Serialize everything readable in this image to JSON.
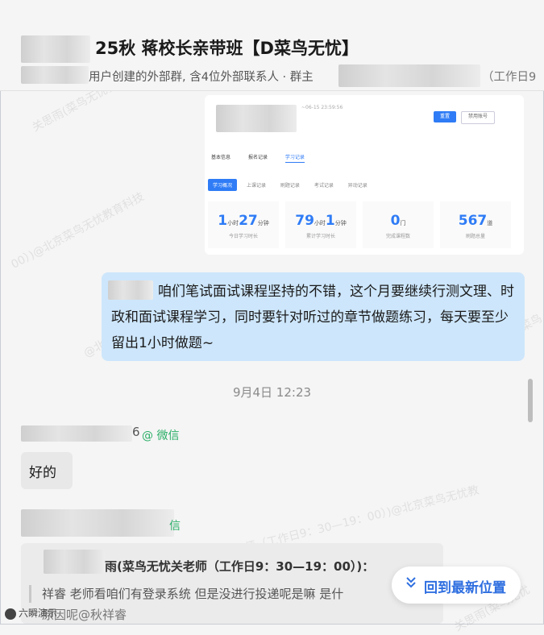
{
  "header": {
    "title_visible": "25秋 蒋校长亲带班【D菜鸟无忧】",
    "subtitle_visible": "用户创建的外部群, 含4位外部联系人 · 群主",
    "subtitle_right_visible": "（工作日9"
  },
  "watermark": {
    "text1": "关思雨(菜鸟无忧教育科技",
    "text2": "00）)@北京菜鸟无忧教育科技",
    "text3": "@北京菜鸟无忧教育科技",
    "text4": "菜鸟无忧关老师（工作日9：30—19：00）)@北京菜鸟无忧教",
    "text5": "关思雨(菜鸟无忧",
    "text6": "关思雨(菜鸟"
  },
  "image_message": {
    "tiny_date": "~06-15 23:59:56",
    "btn_primary": "重置",
    "btn_secondary": "禁用账号",
    "tabs": [
      "基本信息",
      "报名记录",
      "学习记录"
    ],
    "subtabs": [
      "学习概况",
      "上课记录",
      "刷题记录",
      "考试记录",
      "异动记录"
    ],
    "stats": [
      {
        "value": "1",
        "unit1": "小时",
        "value2": "27",
        "unit2": "分钟",
        "label": "今日学习时长"
      },
      {
        "value": "79",
        "unit1": "小时",
        "value2": "1",
        "unit2": "分钟",
        "label": "累计学习时长"
      },
      {
        "value": "0",
        "unit1": "门",
        "value2": "",
        "unit2": "",
        "label": "完成课程数"
      },
      {
        "value": "567",
        "unit1": "道",
        "value2": "",
        "unit2": "",
        "label": "刷题总量"
      }
    ]
  },
  "outgoing_message": {
    "text": "咱们笔试面试课程坚持的不错，这个月要继续行测文理、时政和面试课程学习，同时要针对听过的章节做题练习，每天要至少留出1小时做题~"
  },
  "timestamp": "9月4日 12:23",
  "message1": {
    "sender_suffix": "6",
    "source": "@ 微信",
    "text": "好的"
  },
  "message2": {
    "source": "信",
    "quote_header": "雨(菜鸟无忧关老师（工作日9：30—19：00）)：",
    "quote_body": "祥睿  老师看咱们有登录系统 但是没进行投递呢是嘛 是什",
    "quote_tail": "原因呢@秋祥睿"
  },
  "jump_button": {
    "icon": "double-chevron-down-icon",
    "label": "回到最新位置"
  },
  "corner_badge": "六瞬演示"
}
